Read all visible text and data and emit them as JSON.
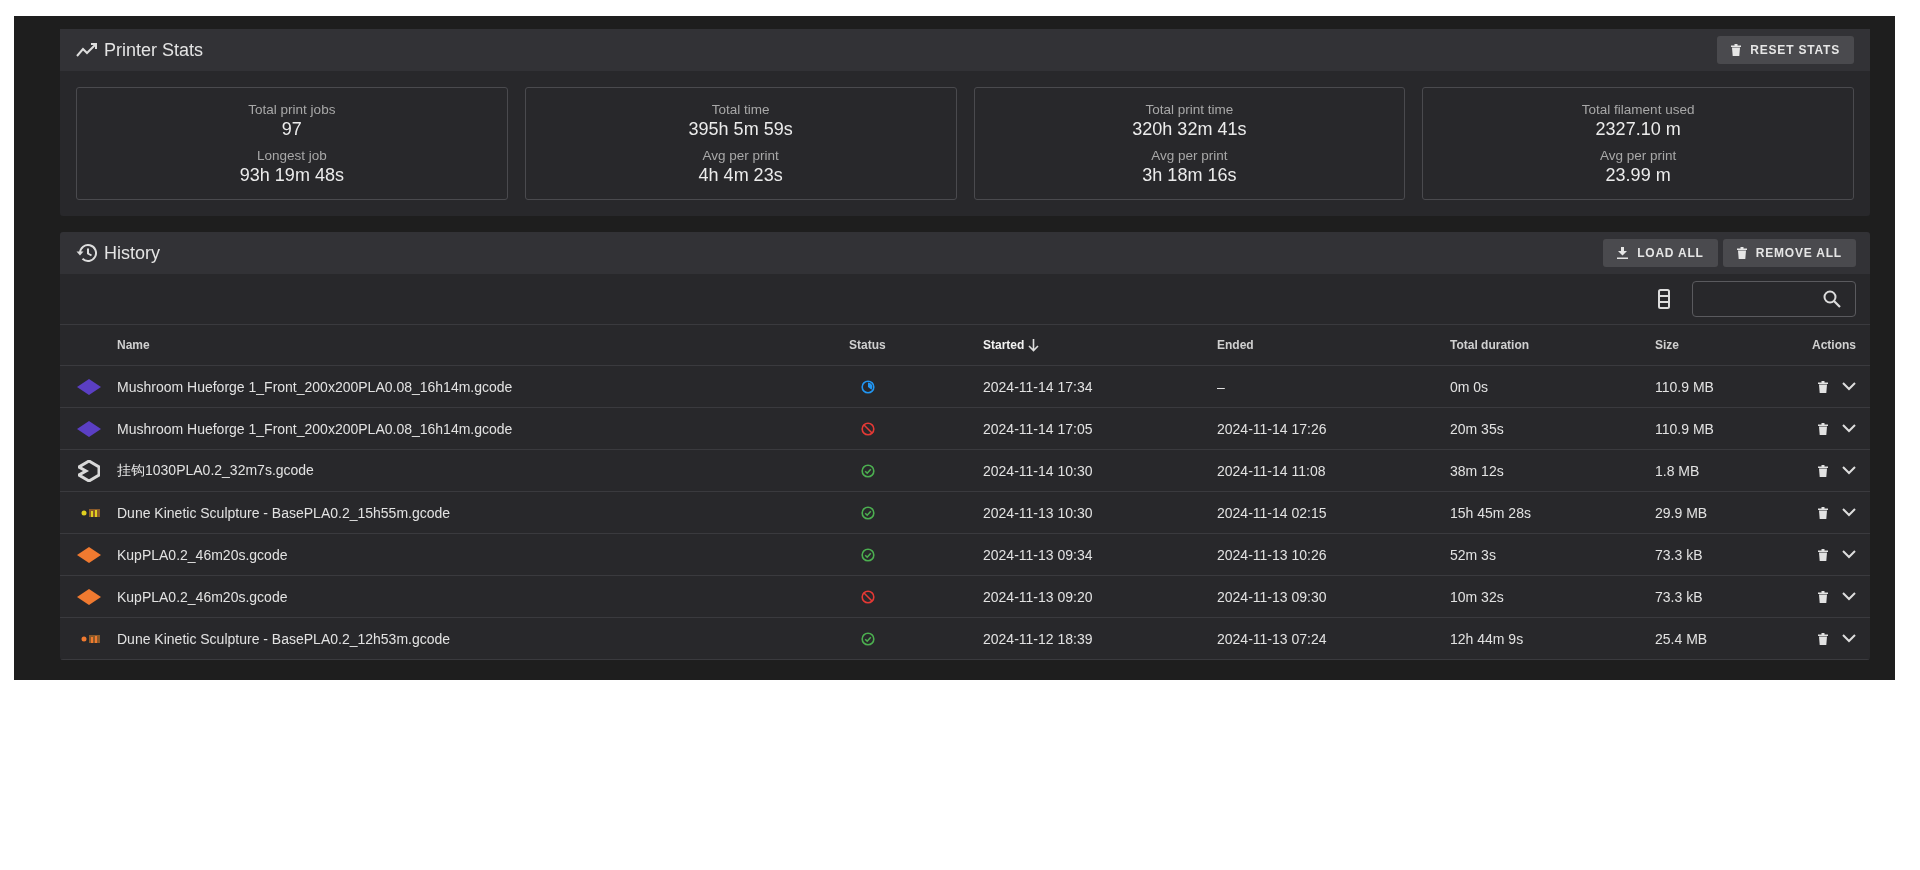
{
  "stats_card": {
    "title": "Printer Stats",
    "reset_button": "RESET STATS",
    "stats": [
      {
        "label": "Total print jobs",
        "value": "97",
        "sub_label": "Longest job",
        "sub_value": "93h 19m 48s"
      },
      {
        "label": "Total time",
        "value": "395h 5m 59s",
        "sub_label": "Avg per print",
        "sub_value": "4h 4m 23s"
      },
      {
        "label": "Total print time",
        "value": "320h 32m 41s",
        "sub_label": "Avg per print",
        "sub_value": "3h 18m 16s"
      },
      {
        "label": "Total filament used",
        "value": "2327.10 m",
        "sub_label": "Avg per print",
        "sub_value": "23.99 m"
      }
    ]
  },
  "history": {
    "title": "History",
    "buttons": [
      "LOAD ALL",
      "REMOVE ALL"
    ],
    "columns": [
      {
        "label": "Name",
        "sorted": false
      },
      {
        "label": "Status",
        "sorted": false
      },
      {
        "label": "Started",
        "sorted": true
      },
      {
        "label": "Ended",
        "sorted": false
      },
      {
        "label": "Total duration",
        "sorted": false
      },
      {
        "label": "Size",
        "sorted": false
      },
      {
        "label": "Actions",
        "sorted": false
      }
    ],
    "rows": [
      {
        "thumbnail": {
          "kind": "tile",
          "color": "#5b3fc4"
        },
        "name": "Mushroom Hueforge 1_Front_200x200PLA0.08_16h14m.gcode",
        "kind": "printing",
        "started": "2024-11-14 17:34",
        "ended": "–",
        "duration": "0m 0s",
        "size": "110.9 MB"
      },
      {
        "thumbnail": {
          "kind": "tile",
          "color": "#5b3fc4"
        },
        "name": "Mushroom Hueforge 1_Front_200x200PLA0.08_16h14m.gcode",
        "kind": "cancelled",
        "started": "2024-11-14 17:05",
        "ended": "2024-11-14 17:26",
        "duration": "20m 35s",
        "size": "110.9 MB"
      },
      {
        "thumbnail": {
          "kind": "hook",
          "color": "#d8d8d8"
        },
        "name": "挂钩1030PLA0.2_32m7s.gcode",
        "kind": "completed",
        "started": "2024-11-14 10:30",
        "ended": "2024-11-14 11:08",
        "duration": "38m 12s",
        "size": "1.8 MB"
      },
      {
        "thumbnail": {
          "kind": "parts",
          "color": "#e0d020"
        },
        "name": "Dune Kinetic Sculpture - BasePLA0.2_15h55m.gcode",
        "kind": "completed",
        "started": "2024-11-13 10:30",
        "ended": "2024-11-14 02:15",
        "duration": "15h 45m 28s",
        "size": "29.9 MB"
      },
      {
        "thumbnail": {
          "kind": "tile",
          "color": "#f07a30"
        },
        "name": "KupPLA0.2_46m20s.gcode",
        "kind": "completed",
        "started": "2024-11-13 09:34",
        "ended": "2024-11-13 10:26",
        "duration": "52m 3s",
        "size": "73.3 kB"
      },
      {
        "thumbnail": {
          "kind": "tile",
          "color": "#f07a30"
        },
        "name": "KupPLA0.2_46m20s.gcode",
        "kind": "cancelled",
        "started": "2024-11-13 09:20",
        "ended": "2024-11-13 09:30",
        "duration": "10m 32s",
        "size": "73.3 kB"
      },
      {
        "thumbnail": {
          "kind": "parts",
          "color": "#f07a30"
        },
        "name": "Dune Kinetic Sculpture - BasePLA0.2_12h53m.gcode",
        "kind": "completed",
        "started": "2024-11-12 18:39",
        "ended": "2024-11-13 07:24",
        "duration": "12h 44m 9s",
        "size": "25.4 MB"
      }
    ]
  }
}
